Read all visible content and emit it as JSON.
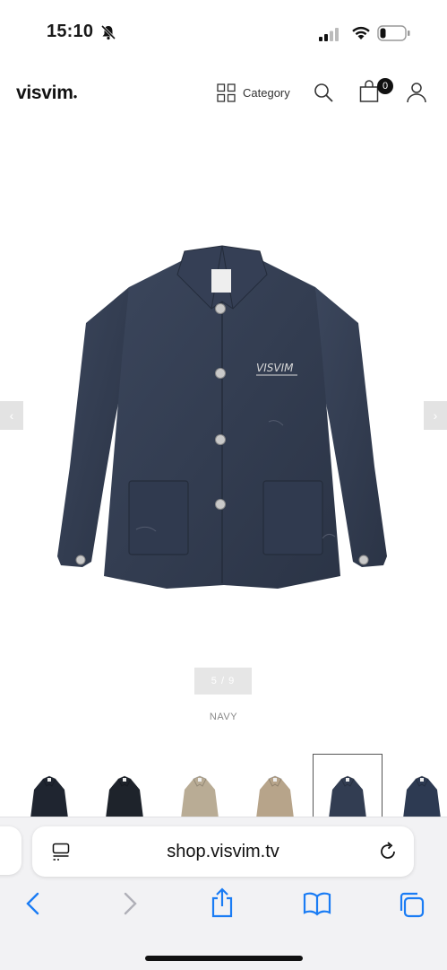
{
  "status": {
    "time": "15:10",
    "icons": [
      "bell-slash-icon",
      "signal-icon",
      "wifi-icon",
      "battery-icon"
    ]
  },
  "header": {
    "logo": "visvim",
    "category_label": "Category",
    "cart_count": "0",
    "icons": [
      "grid-icon",
      "search-icon",
      "bag-icon",
      "user-icon"
    ]
  },
  "gallery": {
    "prev_arrow": "‹",
    "next_arrow": "›",
    "counter": "5 / 9",
    "color_name": "NAVY",
    "logo_script": "VISVIM"
  },
  "thumbnails": [
    {
      "color": "#1f2530",
      "selected": false
    },
    {
      "color": "#1e232b",
      "selected": false
    },
    {
      "color": "#b9ac95",
      "selected": false
    },
    {
      "color": "#b7a48a",
      "selected": false
    },
    {
      "color": "#323d52",
      "selected": true
    },
    {
      "color": "#2d3a52",
      "selected": false
    }
  ],
  "browser": {
    "url": "shop.visvim.tv",
    "icons": [
      "reader-icon",
      "reload-icon",
      "back-icon",
      "forward-icon",
      "share-icon",
      "bookmarks-icon",
      "tabs-icon"
    ]
  },
  "colors": {
    "accent": "#1a7cf4",
    "jacket": "#333d52",
    "disabled": "#b0b0b8"
  }
}
